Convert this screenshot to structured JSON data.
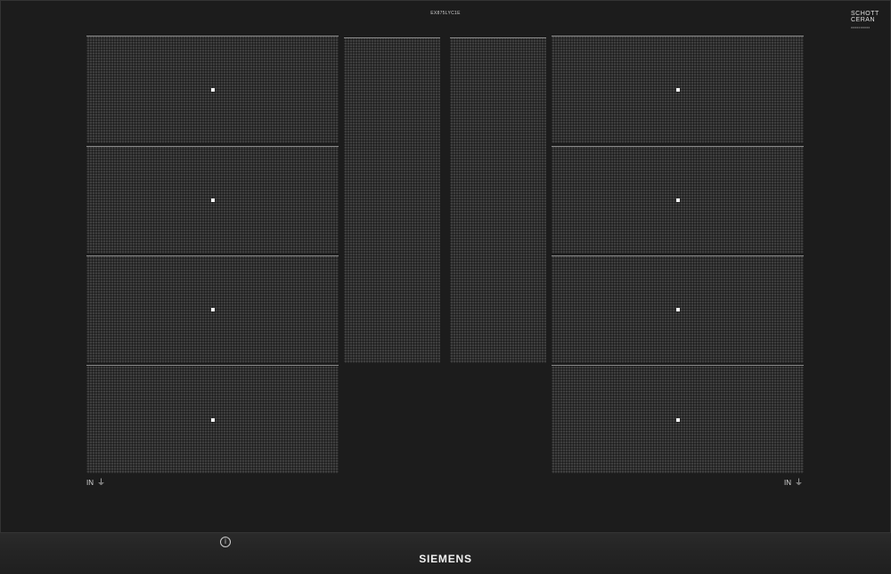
{
  "hob": {
    "model_number": "EX875LYC1E",
    "schott": {
      "line1": "SCHOTT",
      "line2": "CERAN",
      "small": "0000000000"
    },
    "left_label": "IN",
    "right_label": "IN",
    "brand": "SIEMENS",
    "info_symbol": "i"
  },
  "colors": {
    "surface": "#1c1c1c",
    "zone": "#3e3e3e",
    "text": "#f2f2f2"
  }
}
